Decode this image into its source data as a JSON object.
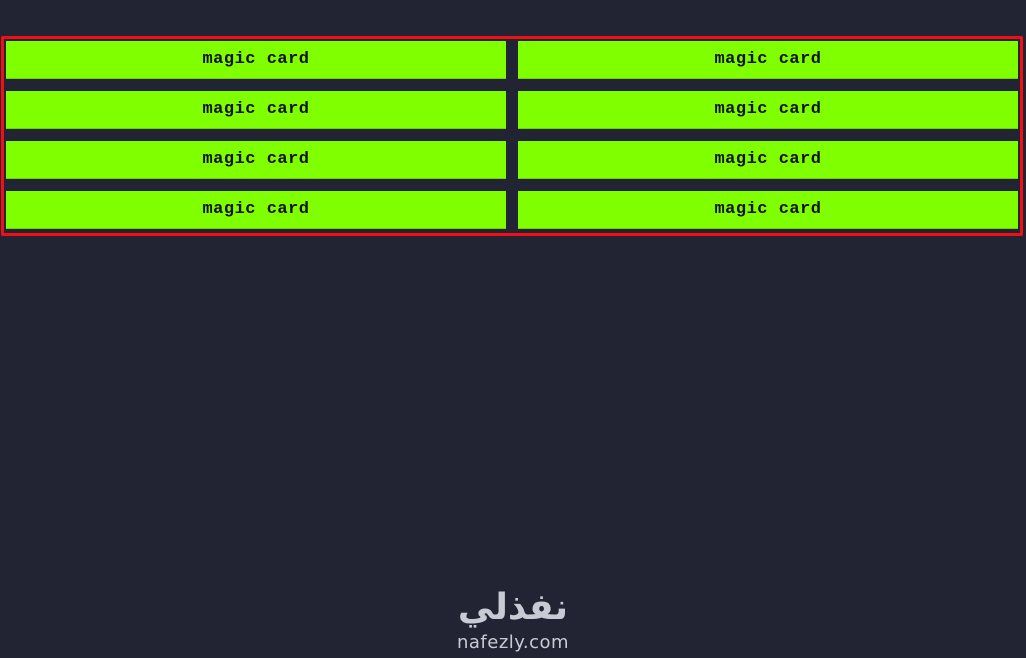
{
  "cards": [
    {
      "label": "magic card"
    },
    {
      "label": "magic card"
    },
    {
      "label": "magic card"
    },
    {
      "label": "magic card"
    },
    {
      "label": "magic card"
    },
    {
      "label": "magic card"
    },
    {
      "label": "magic card"
    },
    {
      "label": "magic card"
    }
  ],
  "watermark": {
    "arabic": "نفذلي",
    "latin": "nafezly.com"
  },
  "colors": {
    "background": "#222433",
    "card": "#7fff00",
    "border": "#f20f14",
    "text": "#111111"
  }
}
